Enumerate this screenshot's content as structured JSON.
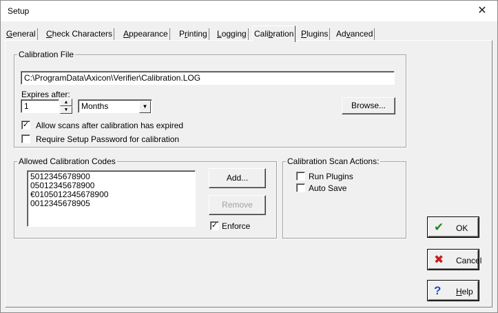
{
  "window": {
    "title": "Setup",
    "close_glyph": "✕"
  },
  "tabs": [
    {
      "pre": "",
      "ul": "G",
      "post": "eneral"
    },
    {
      "pre": "",
      "ul": "C",
      "post": "heck Characters"
    },
    {
      "pre": "",
      "ul": "A",
      "post": "ppearance"
    },
    {
      "pre": "P",
      "ul": "r",
      "post": "inting"
    },
    {
      "pre": "",
      "ul": "L",
      "post": "ogging"
    },
    {
      "pre": "Cali",
      "ul": "b",
      "post": "ration"
    },
    {
      "pre": "",
      "ul": "P",
      "post": "lugins"
    },
    {
      "pre": "Ad",
      "ul": "v",
      "post": "anced"
    }
  ],
  "active_tab": "Calibration",
  "calibration_file": {
    "group_title": "Calibration File",
    "path": "C:\\ProgramData\\Axicon\\Verifier\\Calibration.LOG",
    "expires_label": "Expires after:",
    "expires_value": "1",
    "expires_unit": "Months",
    "browse_label": "Browse...",
    "allow_scans_label": "Allow scans after calibration has expired",
    "allow_scans_checked": true,
    "require_pw_label": "Require Setup Password for calibration",
    "require_pw_checked": false
  },
  "allowed_codes": {
    "group_title": "Allowed Calibration Codes",
    "items": [
      "5012345678900",
      "05012345678900",
      "€0105012345678900",
      "0012345678905"
    ],
    "add_label": "Add...",
    "remove_label": "Remove",
    "enforce_label": "Enforce",
    "enforce_checked": true
  },
  "scan_actions": {
    "group_title": "Calibration Scan Actions:",
    "run_plugins_label": "Run Plugins",
    "run_plugins_checked": false,
    "auto_save_label": "Auto Save",
    "auto_save_checked": false
  },
  "dialog_buttons": {
    "ok_label": "OK",
    "cancel_label": "Cancel",
    "help_ul": "H",
    "help_post": "elp"
  },
  "colors": {
    "ok_check": "#1e8a1e",
    "cancel_x": "#c81e1e",
    "help_q": "#1e50c8"
  }
}
